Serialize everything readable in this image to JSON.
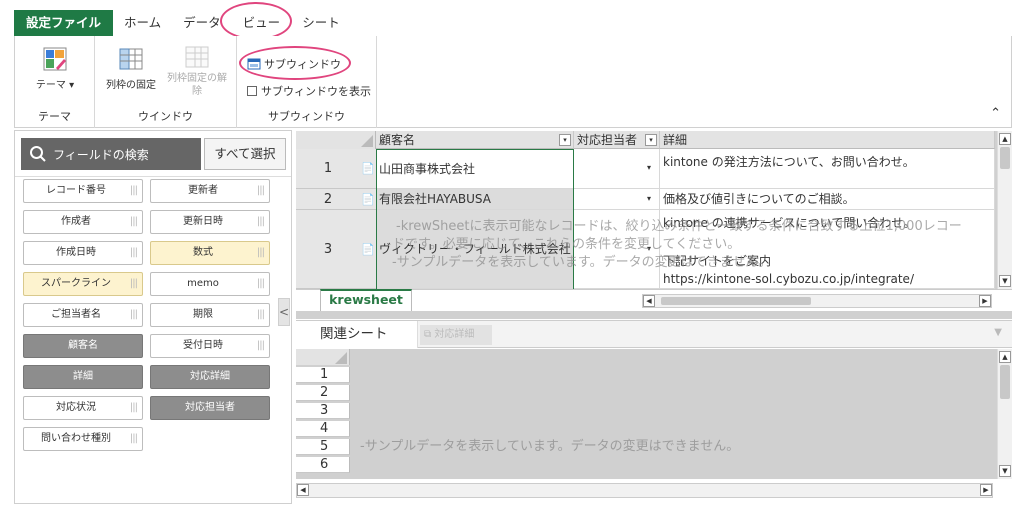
{
  "ribbon_tabs": [
    "設定ファイル",
    "ホーム",
    "データ",
    "ビュー",
    "シート"
  ],
  "ribbon": {
    "groups": [
      {
        "label": "テーマ",
        "buttons": [
          "テーマ ▾"
        ]
      },
      {
        "label": "ウインドウ",
        "buttons": [
          "列枠の固定",
          "列枠固定の解除"
        ]
      },
      {
        "label": "サブウィンドウ",
        "buttons": [
          "サブウィンドウ",
          "サブウィンドウを表示"
        ]
      }
    ],
    "theme_label": "テーマ",
    "theme_caret": "▾",
    "freeze_label": "列枠の固定",
    "unfreeze_label": "列枠固定の解除",
    "subwindow_label": "サブウィンドウ",
    "show_subwindow_label": "サブウィンドウを表示",
    "collapse_glyph": "⌃"
  },
  "field_panel": {
    "search_placeholder": "フィールドの検索",
    "select_all": "すべて選択",
    "fields": [
      {
        "label": "レコード番号",
        "style": "normal"
      },
      {
        "label": "更新者",
        "style": "normal"
      },
      {
        "label": "作成者",
        "style": "normal"
      },
      {
        "label": "更新日時",
        "style": "normal"
      },
      {
        "label": "作成日時",
        "style": "normal"
      },
      {
        "label": "数式",
        "style": "yellow"
      },
      {
        "label": "スパークライン",
        "style": "yellow"
      },
      {
        "label": "memo",
        "style": "normal"
      },
      {
        "label": "ご担当者名",
        "style": "normal"
      },
      {
        "label": "期限",
        "style": "normal"
      },
      {
        "label": "顧客名",
        "style": "dark"
      },
      {
        "label": "受付日時",
        "style": "normal"
      },
      {
        "label": "詳細",
        "style": "dark"
      },
      {
        "label": "対応詳細",
        "style": "dark"
      },
      {
        "label": "対応状況",
        "style": "normal"
      },
      {
        "label": "対応担当者",
        "style": "dark"
      },
      {
        "label": "問い合わせ種別",
        "style": "normal"
      }
    ],
    "grip": "|||",
    "splitter_glyph": "<"
  },
  "sheet": {
    "columns": [
      "顧客名",
      "対応担当者",
      "詳細"
    ],
    "rows": [
      {
        "num": "1",
        "customer": "山田商事株式会社",
        "detail": [
          "kintone の発注方法について、お問い合わせ。"
        ]
      },
      {
        "num": "2",
        "customer": "有限会社HAYABUSA",
        "detail": [
          "価格及び値引きについてのご相談。"
        ]
      },
      {
        "num": "3",
        "customer": "ヴィクトリー・フィールド株式会社",
        "detail": [
          "kintone の連携サービスについて問い合わせ。",
          "下記サイトをご案内",
          "https://kintone-sol.cybozu.co.jp/integrate/"
        ]
      }
    ],
    "watermark_line1": "-krewSheetに表示可能なレコードは、絞り込み条件と一致する条件に合致する上位1,000レコー",
    "watermark_line2": "ドです。必要に応じて、これらの条件を変更してください。",
    "watermark_line3": "-サンプルデータを表示しています。データの変更はできません。",
    "sheet_tab": "krewsheet",
    "doc_glyph": "📄",
    "dropdown_glyph": "▾"
  },
  "related": {
    "tab_label": "関連シート",
    "field_chip": "対応詳細",
    "row_numbers": [
      "1",
      "2",
      "3",
      "4",
      "5",
      "6"
    ],
    "watermark": "-サンプルデータを表示しています。データの変更はできません。"
  }
}
